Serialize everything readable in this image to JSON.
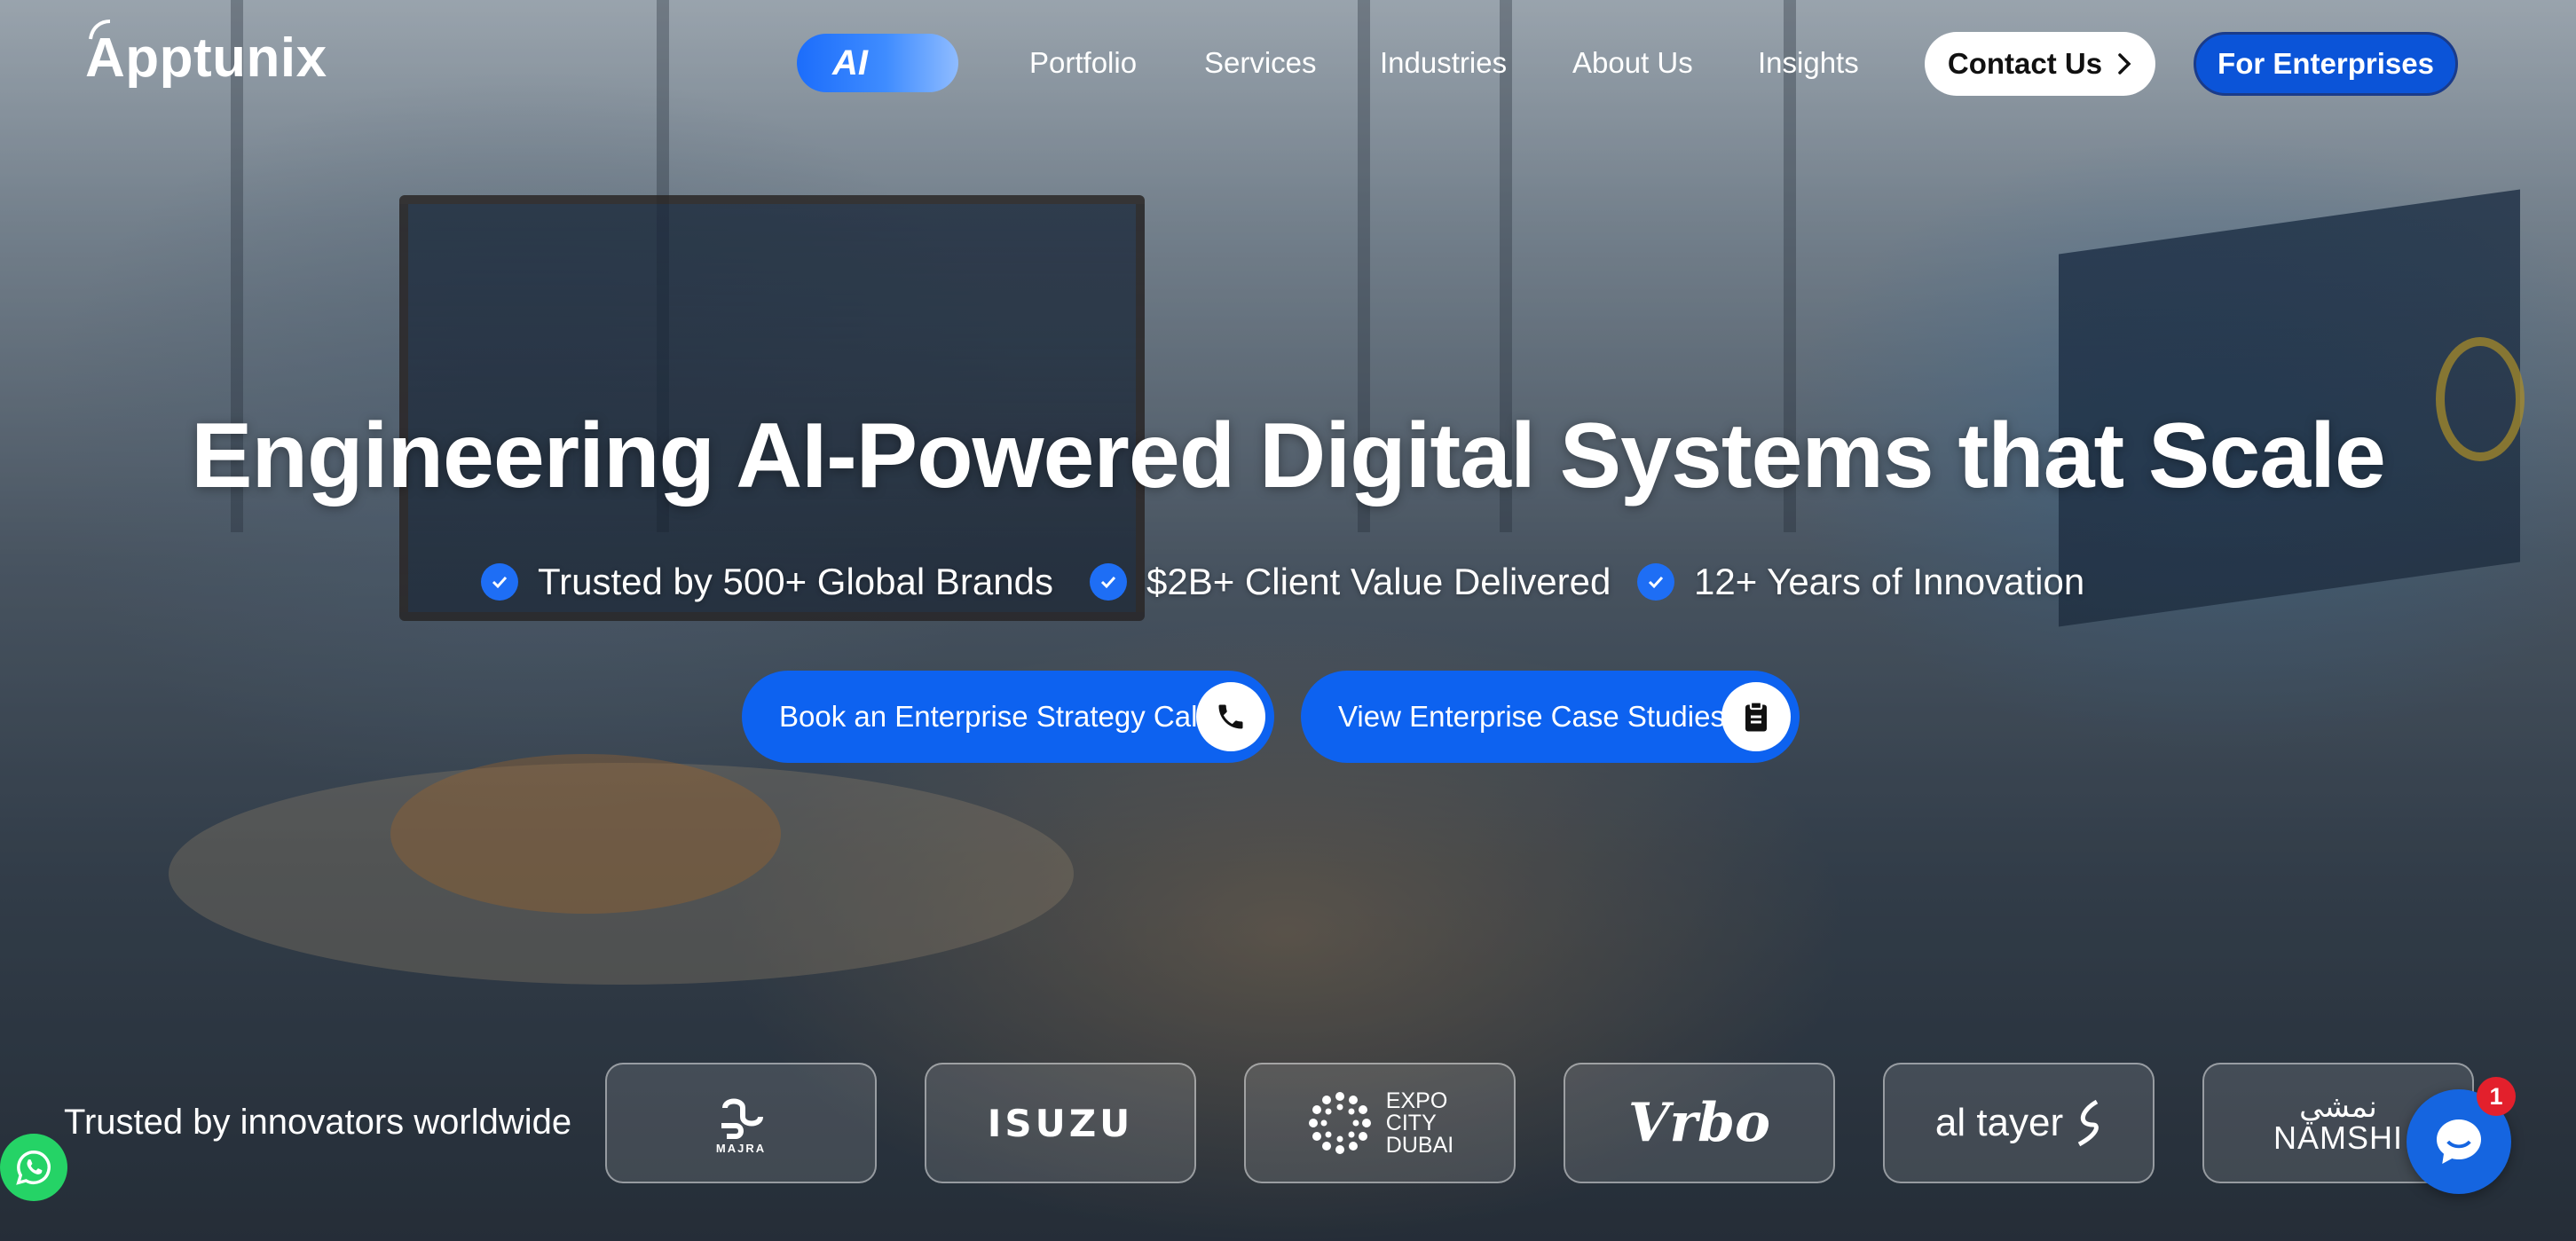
{
  "brand": {
    "name": "Apptunix"
  },
  "nav": {
    "ai_label": "AI",
    "links": [
      "Portfolio",
      "Services",
      "Industries",
      "About Us",
      "Insights"
    ],
    "contact_label": "Contact Us",
    "enterprise_label": "For Enterprises"
  },
  "hero": {
    "title": "Engineering AI-Powered Digital Systems that Scale",
    "stats": [
      "Trusted by 500+ Global Brands",
      "$2B+ Client Value Delivered",
      "12+ Years of Innovation"
    ],
    "cta_primary": "Book an Enterprise Strategy Call",
    "cta_secondary": "View Enterprise Case Studies"
  },
  "trusted": {
    "label": "Trusted by innovators worldwide",
    "logos": [
      {
        "name": "majra-logo",
        "text": "MAJRA"
      },
      {
        "name": "isuzu-logo",
        "text": "ISUZU"
      },
      {
        "name": "expo-city-dubai-logo",
        "lines": [
          "EXPO",
          "CITY",
          "DUBAI"
        ]
      },
      {
        "name": "vrbo-logo",
        "text": "Vrbo"
      },
      {
        "name": "al-tayer-logo",
        "text": "al tayer"
      },
      {
        "name": "namshi-logo",
        "text": "NAMSHI",
        "arabic": "نمشي"
      }
    ]
  },
  "chat": {
    "badge_count": "1"
  },
  "colors": {
    "accent": "#0d62f0",
    "ai_gradient_start": "#1c6dfb",
    "whatsapp": "#25d366",
    "badge": "#e3202c"
  },
  "icons": {
    "cta_primary": "phone-icon",
    "cta_secondary": "clipboard-icon",
    "contact": "chevron-right-icon",
    "stat": "check-circle-icon",
    "whatsapp": "whatsapp-icon",
    "chat": "chat-bubble-icon"
  }
}
